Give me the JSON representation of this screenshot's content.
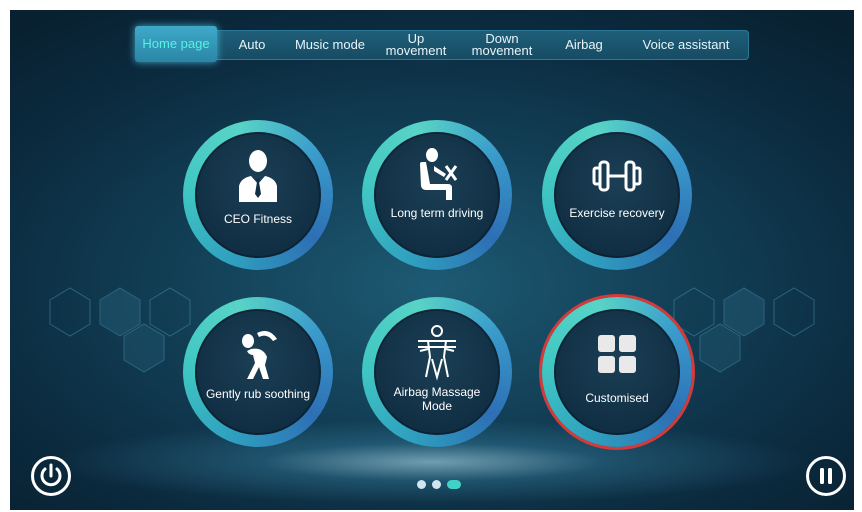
{
  "nav": {
    "items": [
      {
        "label": "Home page",
        "active": true
      },
      {
        "label": "Auto",
        "active": false
      },
      {
        "label": "Music mode",
        "active": false
      },
      {
        "label": "Up\nmovement",
        "active": false
      },
      {
        "label": "Down\nmovement",
        "active": false
      },
      {
        "label": "Airbag",
        "active": false
      },
      {
        "label": "Voice assistant",
        "active": false
      }
    ]
  },
  "modes": [
    {
      "label": "CEO Fitness",
      "icon": "businessman-icon"
    },
    {
      "label": "Long term driving",
      "icon": "driver-seat-icon"
    },
    {
      "label": "Exercise recovery",
      "icon": "dumbbell-icon"
    },
    {
      "label": "Gently rub soothing",
      "icon": "stretching-person-icon"
    },
    {
      "label": "Airbag Massage Mode",
      "icon": "body-massage-icon"
    },
    {
      "label": "Customised",
      "icon": "grid-icon",
      "selected": true
    }
  ],
  "pagination": {
    "pages": 3,
    "current": 3
  },
  "colors": {
    "accent": "#3fd2c7",
    "selected_ring": "#d43a3a",
    "background": "#123f56"
  }
}
